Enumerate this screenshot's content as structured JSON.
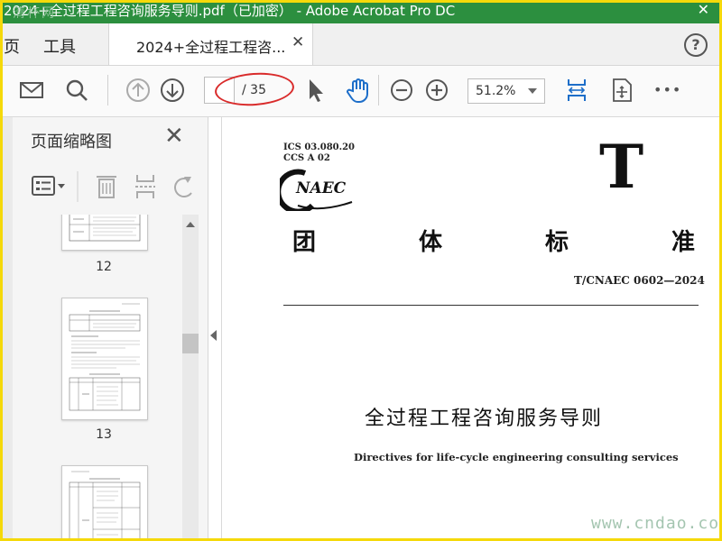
{
  "window": {
    "title": "2024+全过程工程咨询服务导则.pdf（已加密） - Adobe Acrobat Pro DC",
    "close_glyph": "✕",
    "watermark_top": "清杯网"
  },
  "tabs": {
    "home_partial": "页",
    "tools": "工具",
    "document": "2024+全过程工程咨...",
    "close_glyph": "✕",
    "help_glyph": "?"
  },
  "toolbar": {
    "page_current": "",
    "page_total": "/ 35",
    "zoom": "51.2%",
    "more": "•••"
  },
  "icons": [
    "mail-icon",
    "search-icon",
    "page-up-icon",
    "page-down-icon",
    "select-cursor-icon",
    "hand-icon",
    "zoom-out-icon",
    "zoom-in-icon",
    "fit-page-icon",
    "full-screen-icon",
    "more-icon"
  ],
  "panel": {
    "title": "页面缩略图",
    "close_glyph": "✕",
    "thumbnails": [
      {
        "label": "12"
      },
      {
        "label": "13"
      },
      {
        "label": ""
      }
    ]
  },
  "document": {
    "ics": "ICS 03.080.20",
    "ccs": "CCS A 02",
    "logo_text": "NAEC",
    "category_letter": "T",
    "heading": [
      "团",
      "体",
      "标",
      "准"
    ],
    "standard_code": "T/CNAEC 0602—2024",
    "title_cn": "全过程工程咨询服务导则",
    "title_en": "Directives for life-cycle engineering consulting services"
  },
  "watermark_bottom": "www.cndao.com",
  "colors": {
    "titlebar": "#2c8f3f",
    "accent_blue": "#1d6ec9",
    "annotation_red": "#d92b2b",
    "frame_yellow": "#f5d90a"
  }
}
